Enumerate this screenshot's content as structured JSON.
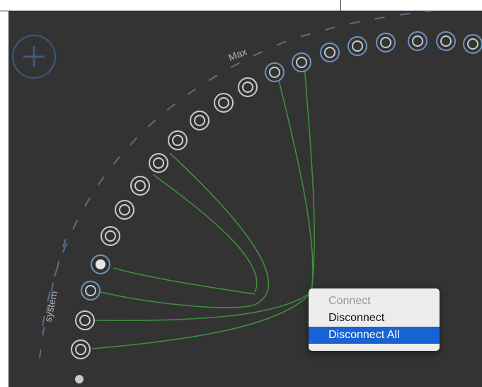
{
  "colors": {
    "background": "#333333",
    "system_port": "#c9c9c9",
    "max_port": "#6f93c0",
    "cable": "#3f8f3f",
    "arc_dash": "#55708f",
    "menu_selected": "#1863d3"
  },
  "labels": {
    "system": "system",
    "max": "Max"
  },
  "add_button": {
    "icon": "plus-icon"
  },
  "context_menu": {
    "items": [
      {
        "label": "Connect",
        "enabled": false,
        "selected": false
      },
      {
        "label": "Disconnect",
        "enabled": true,
        "selected": false
      },
      {
        "label": "Disconnect All",
        "enabled": true,
        "selected": true
      }
    ]
  }
}
